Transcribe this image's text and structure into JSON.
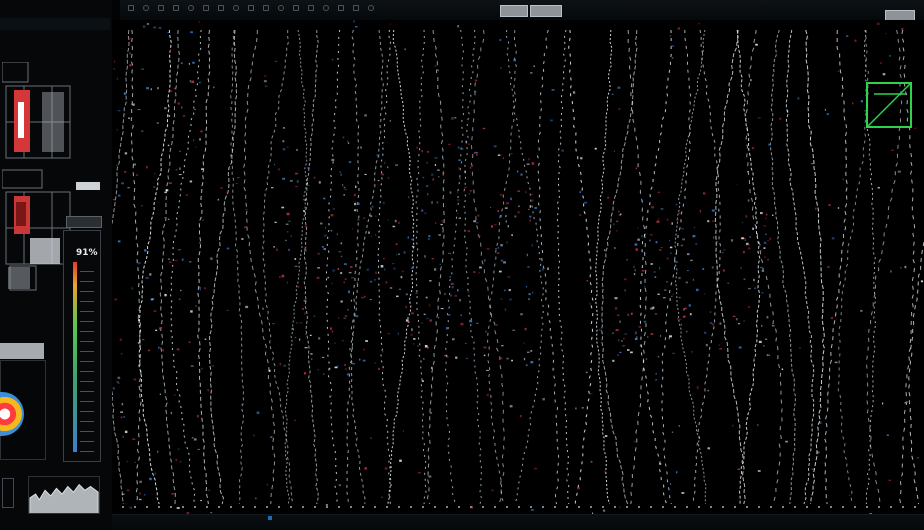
{
  "toolbar": {
    "button_1": "",
    "button_2": "",
    "button_3": "",
    "icons": [
      "grid-icon",
      "cursor-icon",
      "zoom-icon",
      "target-icon",
      "layer-icon",
      "settings-icon",
      "ruler-icon",
      "marker-icon",
      "save-icon",
      "export-icon",
      "filter-icon",
      "info-icon",
      "measure-icon",
      "camera-icon",
      "chart-icon",
      "sync-icon",
      "lock-icon"
    ]
  },
  "gauge": {
    "value_label": "91%",
    "level": 0.91
  },
  "colors": {
    "target_box": "#2fd24b",
    "scan_line": "#e6eef2",
    "noise_red": "#c0304a",
    "noise_blue": "#3a7fd0"
  }
}
